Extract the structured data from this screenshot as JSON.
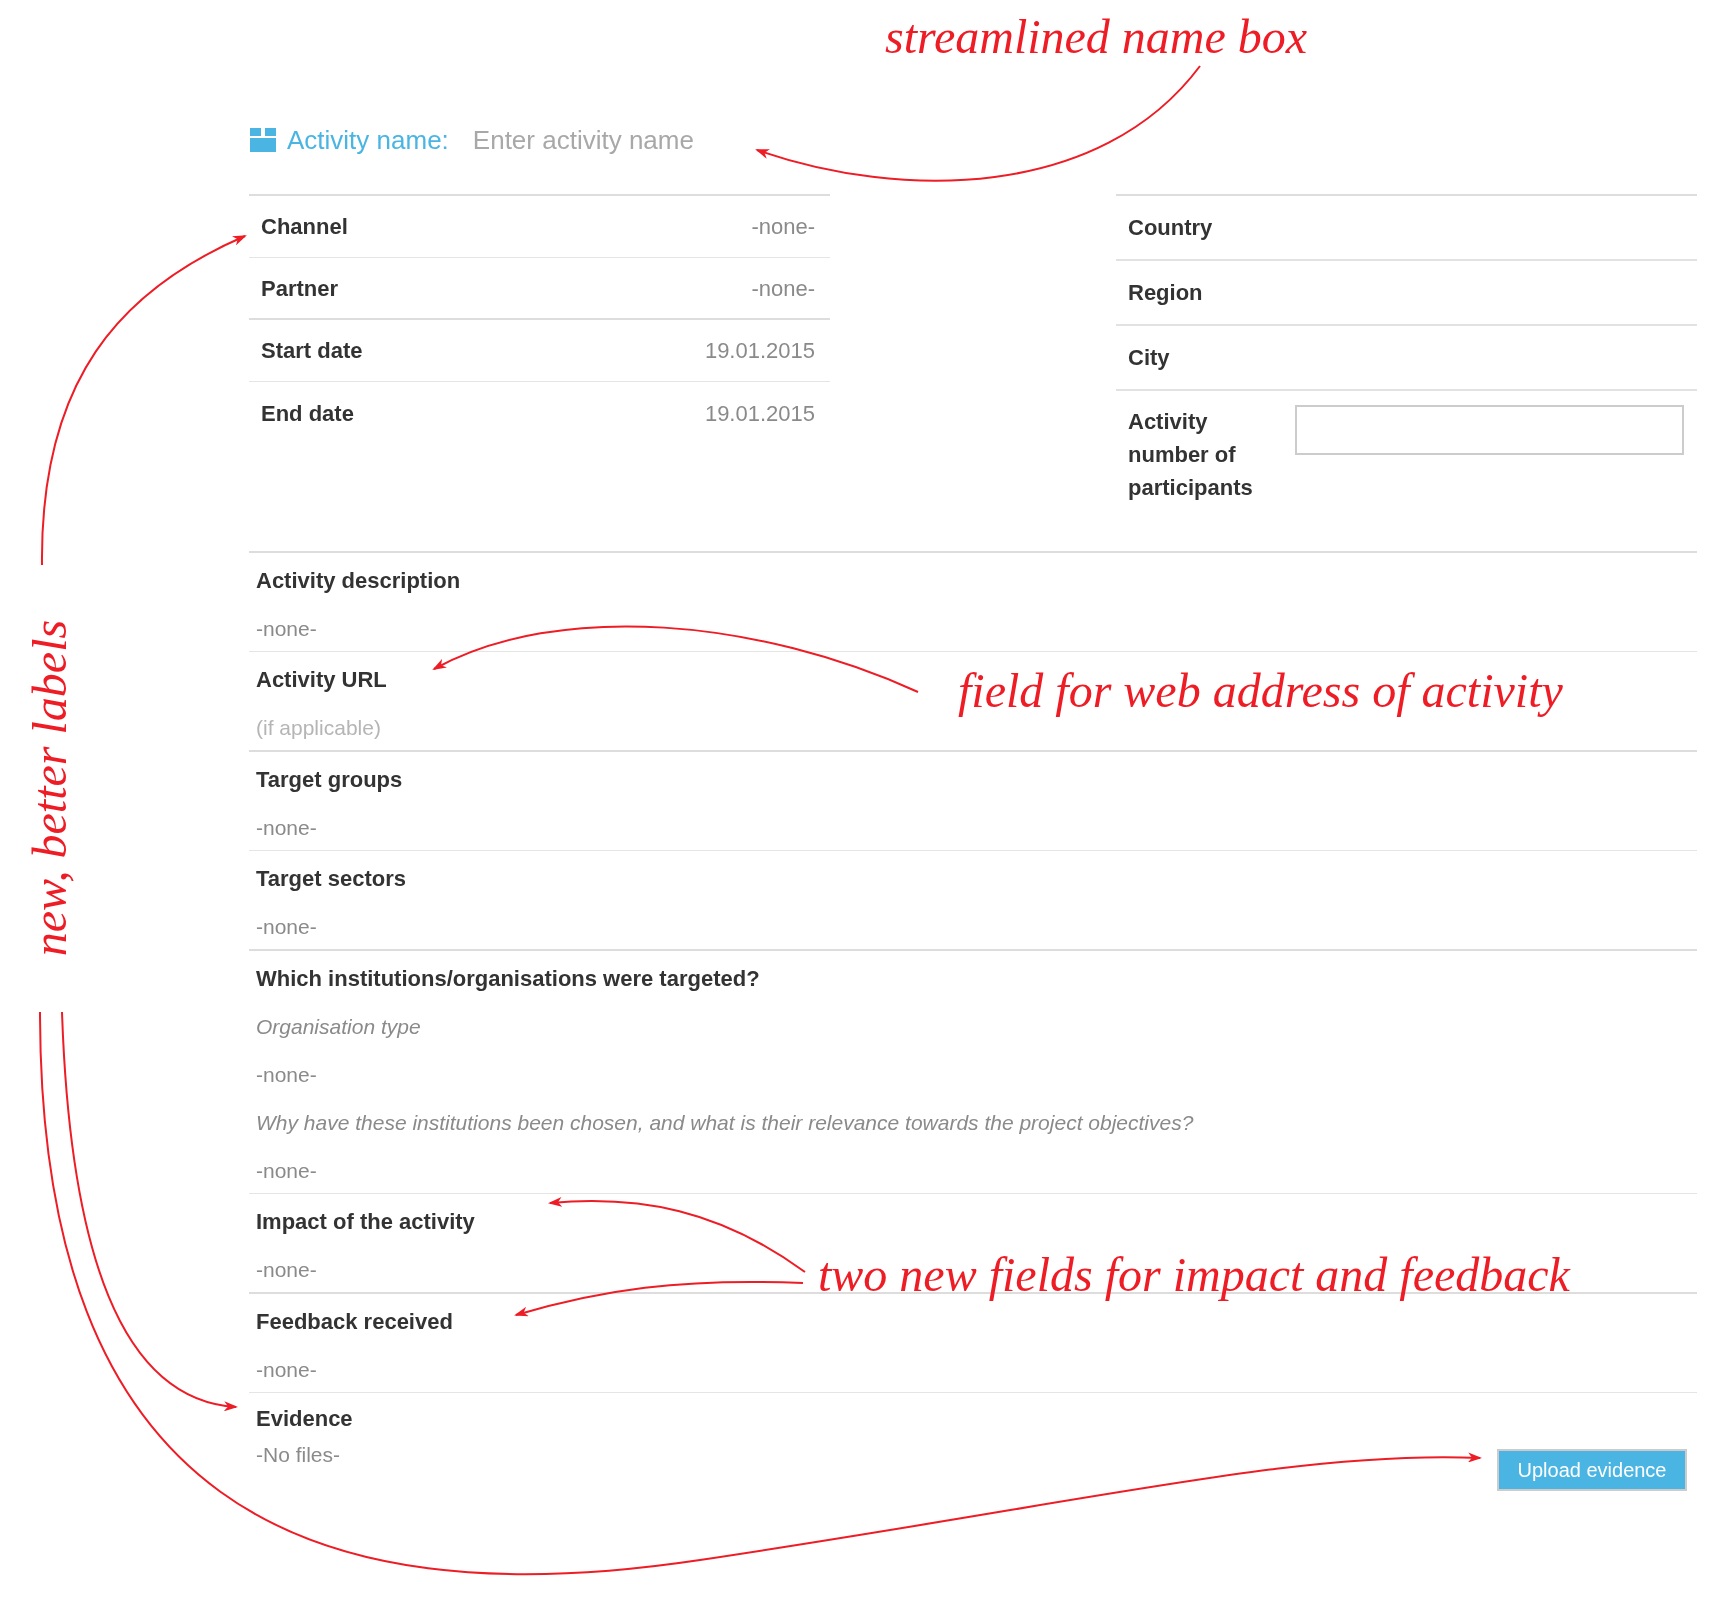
{
  "activity_name": {
    "label": "Activity name:",
    "placeholder": "Enter activity name"
  },
  "details_left": [
    {
      "label": "Channel",
      "value": "-none-"
    },
    {
      "label": "Partner",
      "value": "-none-"
    },
    {
      "label": "Start date",
      "value": "19.01.2015"
    },
    {
      "label": "End date",
      "value": "19.01.2015"
    }
  ],
  "details_right": [
    {
      "label": "Country",
      "kind": "text"
    },
    {
      "label": "Region",
      "kind": "text"
    },
    {
      "label": "City",
      "kind": "text"
    },
    {
      "label": "Activity number of participants",
      "kind": "input"
    }
  ],
  "sections": [
    {
      "title": "Activity description",
      "items": [
        {
          "kind": "value",
          "text": "-none-"
        }
      ]
    },
    {
      "title": "Activity URL",
      "items": [
        {
          "kind": "hint",
          "text": "(if applicable)"
        }
      ]
    },
    {
      "title": "Target groups",
      "items": [
        {
          "kind": "value",
          "text": "-none-"
        }
      ]
    },
    {
      "title": "Target sectors",
      "items": [
        {
          "kind": "value",
          "text": "-none-"
        }
      ]
    },
    {
      "title": "Which institutions/organisations were targeted?",
      "items": [
        {
          "kind": "question",
          "text": "Organisation type"
        },
        {
          "kind": "value",
          "text": "-none-"
        },
        {
          "kind": "question",
          "text": "Why have these institutions been chosen, and what is their relevance towards the project objectives?"
        },
        {
          "kind": "value",
          "text": "-none-"
        }
      ]
    },
    {
      "title": "Impact of the activity",
      "items": [
        {
          "kind": "value",
          "text": "-none-"
        }
      ]
    },
    {
      "title": "Feedback received",
      "items": [
        {
          "kind": "value",
          "text": "-none-"
        }
      ]
    }
  ],
  "evidence": {
    "title": "Evidence",
    "files": "-No files-",
    "button": "Upload evidence"
  },
  "annotations": [
    {
      "text": "streamlined name box"
    },
    {
      "text": "field for web address of activity"
    },
    {
      "text": "two new fields for impact and feedback"
    },
    {
      "text": "new, better labels"
    }
  ]
}
